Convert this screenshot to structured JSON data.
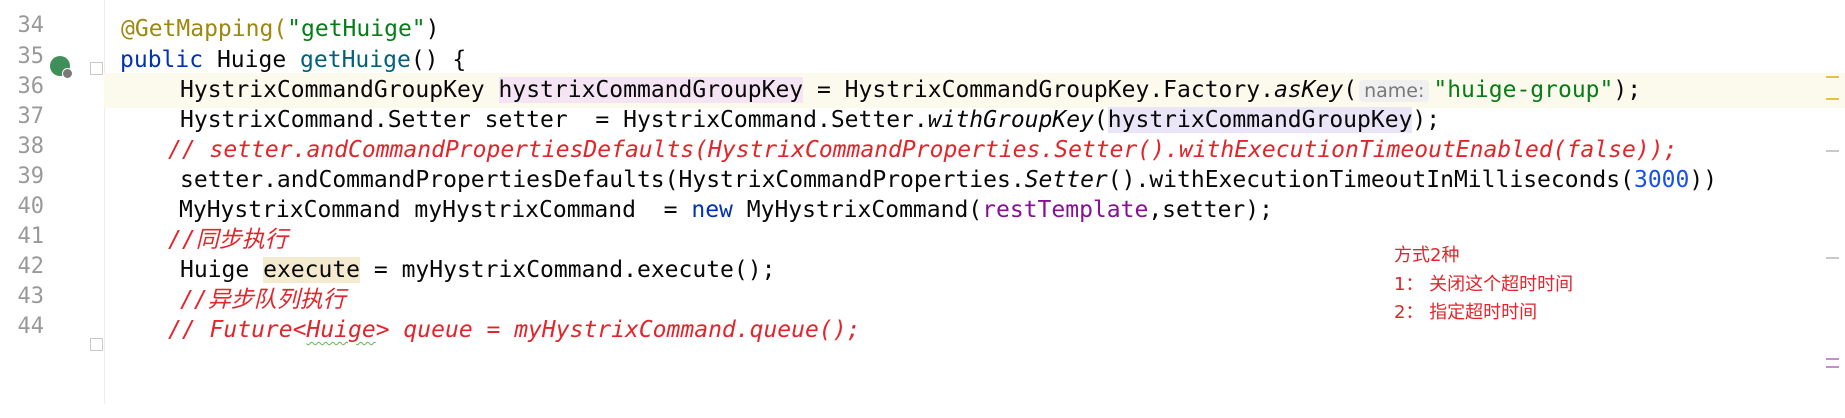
{
  "gutter": {
    "line_numbers": [
      "34",
      "35",
      "36",
      "37",
      "38",
      "39",
      "40",
      "41",
      "42",
      "43",
      "44"
    ]
  },
  "code": {
    "l34": {
      "annotation": "@GetMapping(",
      "string": "\"getHuige\"",
      "close": ")"
    },
    "l35": {
      "kw": "public",
      "type": " Huige ",
      "method": "getHuige",
      "rest": "() {"
    },
    "l36": {
      "type": "HystrixCommandGroupKey ",
      "var": "hystrixCommandGroupKey",
      "mid": " = HystrixCommandGroupKey.Factory.",
      "call": "asKey",
      "open": "(",
      "hint": "name:",
      "string": "\"huige-group\"",
      "end": ");"
    },
    "l37": {
      "pre": "HystrixCommand.Setter setter  = HystrixCommand.Setter.",
      "call": "withGroupKey",
      "open": "(",
      "arg": "hystrixCommandGroupKey",
      "end": ");"
    },
    "l38": {
      "comment": "// setter.andCommandPropertiesDefaults(HystrixCommandProperties.Setter().withExecutionTimeoutEnabled(false));"
    },
    "l39": {
      "pre": "setter.andCommandPropertiesDefaults(HystrixCommandProperties.",
      "call": "Setter",
      "mid": "().withExecutionTimeoutInMilliseconds(",
      "num": "3000",
      "end": "))"
    },
    "l40": {
      "pre": "MyHystrixCommand myHystrixCommand  = ",
      "kw": "new",
      "mid": " MyHystrixCommand(",
      "field": "restTemplate",
      "end": ",setter);"
    },
    "l41": {
      "comment": "//同步执行"
    },
    "l42": {
      "pre": "Huige ",
      "var": "execute",
      "end": " = myHystrixCommand.execute();"
    },
    "l43": {
      "comment": "//异步队列执行"
    },
    "l44": {
      "pre": "// Future<",
      "mid": "Huige",
      "end": "> queue = myHystrixCommand.queue();"
    }
  },
  "note": {
    "title": "方式2种",
    "line1": "1： 关闭这个超时时间",
    "line2": "2： 指定超时时间"
  },
  "colors": {
    "comment": "#e3242b",
    "keyword": "#0033b3",
    "string": "#067d17",
    "annotation": "#9e880d",
    "method": "#00627a",
    "field": "#871094",
    "number": "#1750eb"
  },
  "icons": [
    "run-spring-icon",
    "fold-marker-icon"
  ]
}
